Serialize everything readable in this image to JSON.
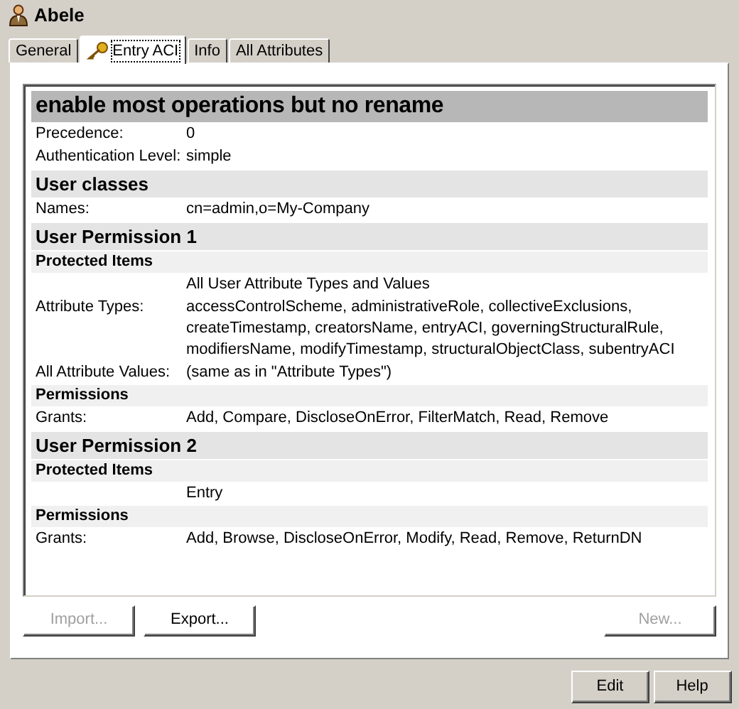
{
  "entry": {
    "title": "Abele"
  },
  "tabs": [
    {
      "label": "General",
      "selected": false
    },
    {
      "label": "Entry ACI",
      "selected": true
    },
    {
      "label": "Info",
      "selected": false
    },
    {
      "label": "All Attributes",
      "selected": false
    }
  ],
  "aci": [
    {
      "kind": "title",
      "text": "enable most operations but no rename"
    },
    {
      "kind": "field",
      "label": "Precedence:",
      "value": "0"
    },
    {
      "kind": "field",
      "label": "Authentication Level:",
      "value": "simple"
    },
    {
      "kind": "section",
      "text": "User classes"
    },
    {
      "kind": "field",
      "label": "Names:",
      "value": "cn=admin,o=My-Company"
    },
    {
      "kind": "section",
      "text": "User Permission 1"
    },
    {
      "kind": "subsection",
      "text": "Protected Items"
    },
    {
      "kind": "field",
      "value": "All User Attribute Types and Values"
    },
    {
      "kind": "field",
      "label": "Attribute Types:",
      "value": "accessControlScheme, administrativeRole, collectiveExclusions, createTimestamp, creatorsName, entryACI, governingStructuralRule, modifiersName, modifyTimestamp, structuralObjectClass, subentryACI"
    },
    {
      "kind": "field",
      "label": "All Attribute Values:",
      "value": "(same as in \"Attribute Types\")"
    },
    {
      "kind": "subsection",
      "text": "Permissions"
    },
    {
      "kind": "field",
      "label": "Grants:",
      "value": "Add, Compare, DiscloseOnError, FilterMatch, Read, Remove"
    },
    {
      "kind": "section",
      "text": "User Permission 2"
    },
    {
      "kind": "subsection",
      "text": "Protected Items"
    },
    {
      "kind": "field",
      "value": "Entry"
    },
    {
      "kind": "subsection",
      "text": "Permissions"
    },
    {
      "kind": "field",
      "label": "Grants:",
      "value": "Add, Browse, DiscloseOnError, Modify, Read, Remove, ReturnDN"
    }
  ],
  "panel_buttons": [
    {
      "label": "Import...",
      "disabled": true
    },
    {
      "label": "Export...",
      "disabled": false
    },
    {
      "label": "New...",
      "disabled": true
    }
  ],
  "dialog_buttons": [
    {
      "label": "Edit",
      "disabled": false
    },
    {
      "label": "Help",
      "disabled": false
    }
  ]
}
